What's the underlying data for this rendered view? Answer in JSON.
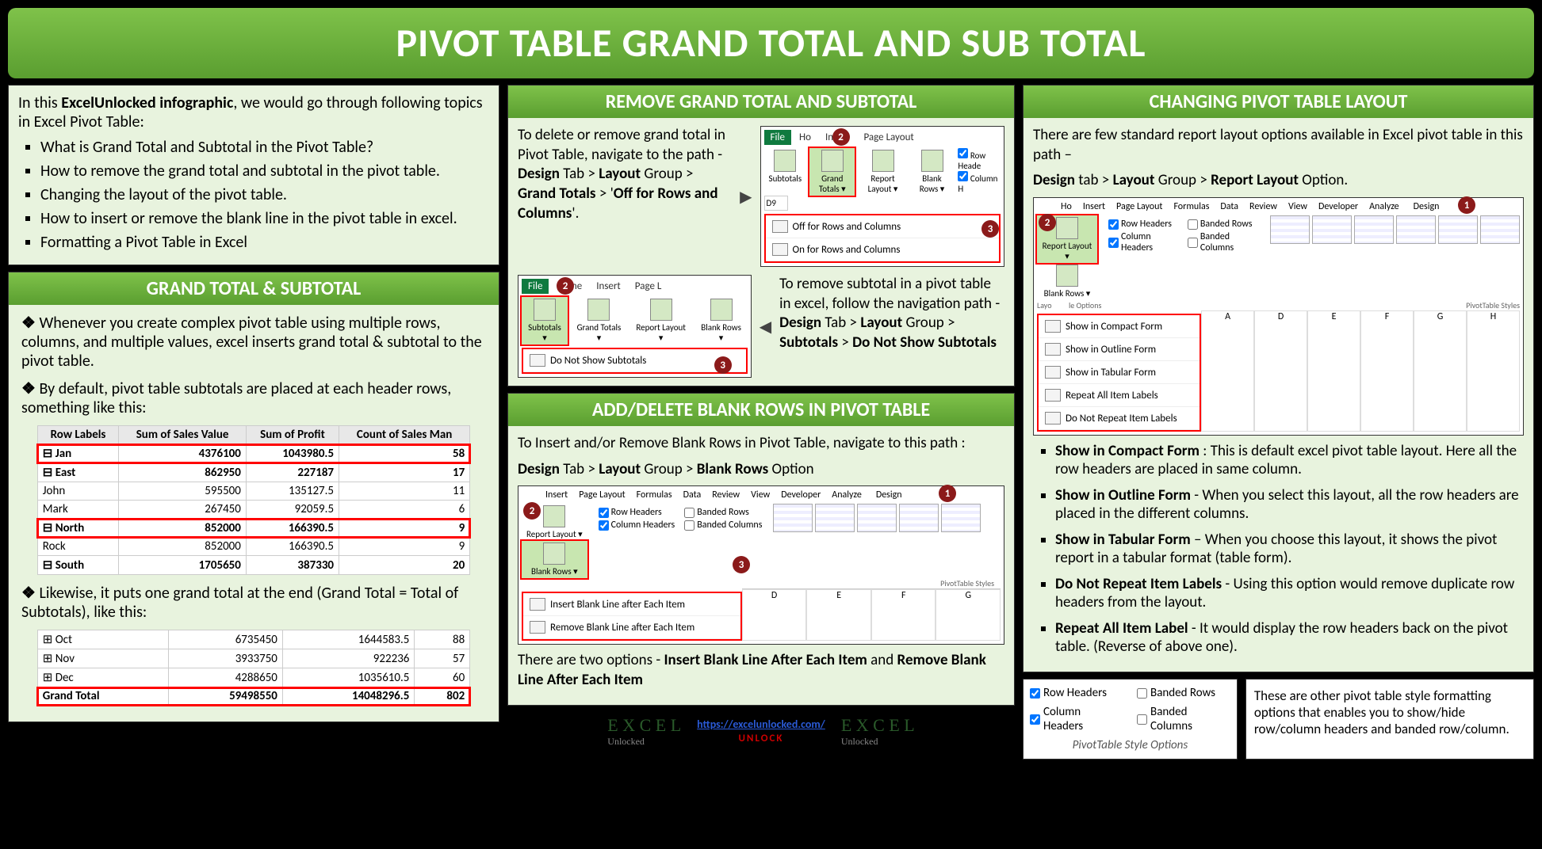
{
  "title": "PIVOT TABLE GRAND TOTAL AND SUB TOTAL",
  "intro": {
    "lead_prefix": "In this ",
    "lead_bold": "ExcelUnlocked infographic",
    "lead_suffix": ", we would go through following topics in Excel Pivot Table:",
    "topics": [
      "What is Grand Total and Subtotal in the Pivot Table?",
      "How to remove the grand total and subtotal in the pivot table.",
      "Changing the layout of the pivot table.",
      "How to insert or remove the blank line in the pivot table in excel.",
      "Formatting a Pivot Table in Excel"
    ]
  },
  "section_gt": {
    "heading": "GRAND TOTAL & SUBTOTAL",
    "p1": "Whenever you create complex pivot table using multiple rows, columns, and multiple values, excel inserts grand total & subtotal to the pivot table.",
    "p2": "By default, pivot table subtotals are placed at each header rows, something like this:",
    "p3": "Likewise, it puts one grand total at the end (Grand Total = Total of Subtotals), like this:",
    "table1": {
      "headers": [
        "Row Labels",
        "Sum of Sales Value",
        "Sum of Profit",
        "Count of Sales Man"
      ],
      "rows": [
        {
          "lbl": "⊟ Jan",
          "v": [
            "4376100",
            "1043980.5",
            "58"
          ],
          "sub": true,
          "hl": true
        },
        {
          "lbl": "⊟ East",
          "v": [
            "862950",
            "227187",
            "17"
          ],
          "sub": true
        },
        {
          "lbl": "   John",
          "v": [
            "595500",
            "135127.5",
            "11"
          ]
        },
        {
          "lbl": "   Mark",
          "v": [
            "267450",
            "92059.5",
            "6"
          ]
        },
        {
          "lbl": "⊟ North",
          "v": [
            "852000",
            "166390.5",
            "9"
          ],
          "sub": true,
          "hl": true
        },
        {
          "lbl": "   Rock",
          "v": [
            "852000",
            "166390.5",
            "9"
          ]
        },
        {
          "lbl": "⊟ South",
          "v": [
            "1705650",
            "387330",
            "20"
          ],
          "sub": true
        }
      ]
    },
    "table2": {
      "rows": [
        {
          "lbl": "⊞ Oct",
          "v": [
            "6735450",
            "1644583.5",
            "88"
          ]
        },
        {
          "lbl": "⊞ Nov",
          "v": [
            "3933750",
            "922236",
            "57"
          ]
        },
        {
          "lbl": "⊞ Dec",
          "v": [
            "4288650",
            "1035610.5",
            "60"
          ]
        },
        {
          "lbl": "Grand Total",
          "v": [
            "59498550",
            "14048296.5",
            "802"
          ],
          "sub": true,
          "hl": true
        }
      ]
    }
  },
  "section_remove": {
    "heading": "REMOVE GRAND TOTAL AND SUBTOTAL",
    "p1a": "To delete or remove grand total in Pivot Table, navigate to the path - ",
    "p1b": "Design",
    "p1c": " Tab > ",
    "p1d": "Layout",
    "p1e": " Group > ",
    "p1f": "Grand Totals",
    "p1g": " > '",
    "p1h": "Off for Rows and Columns",
    "p1i": "'.",
    "p2a": "To remove subtotal in a pivot table in excel, follow the navigation path - ",
    "p2b": "Design",
    "p2c": " Tab > ",
    "p2d": "Layout",
    "p2e": " Group > ",
    "p2f": "Subtotals",
    "p2g": " > ",
    "p2h": "Do Not Show Subtotals",
    "ribbon1": {
      "tabs": [
        "File",
        "Ho",
        "Insert",
        "Page Layout"
      ],
      "buttons": [
        "Subtotals",
        "Grand Totals ▾",
        "Report Layout ▾",
        "Blank Rows ▾"
      ],
      "checks": [
        "Row Heade",
        "Column H"
      ],
      "cell": "D9",
      "menu": [
        "Off for Rows and Columns",
        "On for Rows and Columns"
      ]
    },
    "ribbon2": {
      "tabs": [
        "File",
        "Home",
        "Insert",
        "Page L"
      ],
      "buttons": [
        "Subtotals ▾",
        "Grand Totals ▾",
        "Report Layout ▾",
        "Blank Rows ▾"
      ],
      "menu": [
        "Do Not Show Subtotals"
      ]
    }
  },
  "section_blank": {
    "heading": "ADD/DELETE BLANK ROWS IN PIVOT TABLE",
    "p1": "To Insert and/or Remove Blank Rows in Pivot Table, navigate to this path :",
    "p2a": "Design",
    "p2b": " Tab > ",
    "p2c": "Layout",
    "p2d": " Group > ",
    "p2e": "Blank Rows",
    "p2f": " Option",
    "ribbon": {
      "tabs": [
        "Insert",
        "Page Layout",
        "Formulas",
        "Data",
        "Review",
        "View",
        "Developer",
        "Analyze",
        "Design"
      ],
      "buttons": [
        "Report Layout ▾",
        "Blank Rows ▾"
      ],
      "checks": [
        "Row Headers",
        "Banded Rows",
        "Column Headers",
        "Banded Columns"
      ],
      "menu": [
        "Insert Blank Line after Each Item",
        "Remove Blank Line after Each Item"
      ],
      "cols": [
        "D",
        "E",
        "F",
        "G"
      ],
      "pts": "PivotTable Styles"
    },
    "p3a": "There are two options - ",
    "p3b": "Insert Blank Line After Each Item",
    "p3c": " and ",
    "p3d": "Remove Blank Line After Each Item"
  },
  "section_layout": {
    "heading": "CHANGING PIVOT TABLE LAYOUT",
    "p1": "There are few standard report layout options available in Excel pivot table in this path –",
    "p2a": "Design",
    "p2b": " tab > ",
    "p2c": "Layout",
    "p2d": " Group > ",
    "p2e": "Report Layout",
    "p2f": " Option.",
    "ribbon": {
      "tabs": [
        "Ho",
        "Insert",
        "Page Layout",
        "Formulas",
        "Data",
        "Review",
        "View",
        "Developer",
        "Analyze",
        "Design"
      ],
      "buttons": [
        "Report Layout ▾",
        "Blank Rows ▾"
      ],
      "checks": [
        "Row Headers",
        "Banded Rows",
        "Column Headers",
        "Banded Columns"
      ],
      "menu": [
        "Show in Compact Form",
        "Show in Outline Form",
        "Show in Tabular Form",
        "Repeat All Item Labels",
        "Do Not Repeat Item Labels"
      ],
      "cols": [
        "A",
        "D",
        "E",
        "F",
        "G",
        "H"
      ],
      "pts": "PivotTable Styles",
      "opt_label": "le Options",
      "layo": "Layo"
    },
    "items": [
      {
        "b": "Show in Compact Form",
        "t": " : This is default excel pivot table layout. Here all the row headers are placed in same column."
      },
      {
        "b": "Show in Outline Form",
        "t": " - When you select this layout, all the row headers are placed in the different columns."
      },
      {
        "b": "Show in Tabular Form",
        "t": " – When you choose this layout, it shows the pivot report in a tabular format (table form)."
      },
      {
        "b": "Do Not Repeat Item Labels",
        "t": " - Using this option would remove duplicate row headers from the layout."
      },
      {
        "b": "Repeat All Item Label",
        "t": " - It would display the row headers back on the pivot table. (Reverse of above one)."
      }
    ]
  },
  "style_opts": {
    "checks": [
      "Row Headers",
      "Banded Rows",
      "Column Headers",
      "Banded Columns"
    ],
    "caption": "PivotTable Style Options",
    "note": "These are other pivot table style formatting options that enables you to show/hide row/column headers and banded row/column."
  },
  "footer": {
    "logo_main": "E X C E L",
    "logo_sub": "Unlocked",
    "url": "https://excelunlocked.com/",
    "unlock": "UNLOCK"
  }
}
